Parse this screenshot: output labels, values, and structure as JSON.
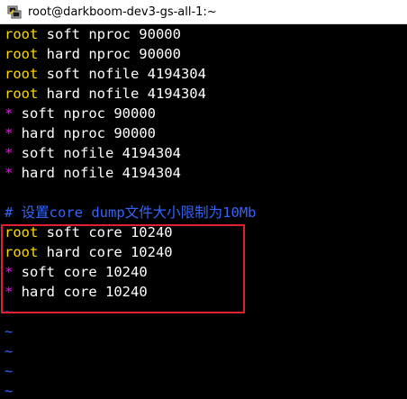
{
  "window": {
    "title": "root@darkboom-dev3-gs-all-1:~",
    "icon": "putty-terminal-icon"
  },
  "colors": {
    "background": "#000000",
    "text": "#ffffff",
    "user_domain": "#ffd800",
    "wildcard_domain": "#ff00ff",
    "comment": "#3264ff",
    "empty_line_tilde": "#3264ff",
    "highlight_box": "#e02030"
  },
  "terminal": {
    "lines": [
      {
        "domain": "root",
        "rest": " soft nproc 90000"
      },
      {
        "domain": "root",
        "rest": " hard nproc 90000"
      },
      {
        "domain": "root",
        "rest": " soft nofile 4194304"
      },
      {
        "domain": "root",
        "rest": " hard nofile 4194304"
      },
      {
        "domain": "*",
        "rest": " soft nproc 90000"
      },
      {
        "domain": "*",
        "rest": " hard nproc 90000"
      },
      {
        "domain": "*",
        "rest": " soft nofile 4194304"
      },
      {
        "domain": "*",
        "rest": " hard nofile 4194304"
      },
      {
        "domain": "",
        "rest": ""
      },
      {
        "comment": "# 设置core dump文件大小限制为10Mb"
      },
      {
        "domain": "root",
        "rest": " soft core 10240"
      },
      {
        "domain": "root",
        "rest": " hard core 10240"
      },
      {
        "domain": "*",
        "rest": " soft core 10240"
      },
      {
        "domain": "*",
        "rest": " hard core 10240"
      }
    ],
    "tildes": [
      "~",
      "~",
      "~",
      "~",
      "~"
    ]
  }
}
